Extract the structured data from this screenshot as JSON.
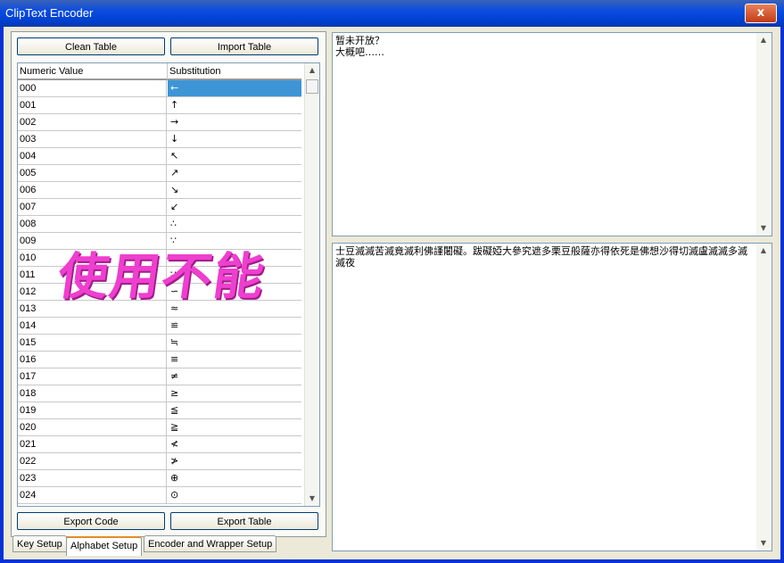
{
  "window": {
    "title": "ClipText Encoder",
    "close_label": "x"
  },
  "buttons": {
    "clean_table": "Clean Table",
    "import_table": "Import Table",
    "export_code": "Export Code",
    "export_table": "Export Table"
  },
  "grid": {
    "headers": [
      "Numeric Value",
      "Substitution"
    ],
    "selected_row": 0,
    "rows": [
      {
        "num": "000",
        "sub": "←"
      },
      {
        "num": "001",
        "sub": "↑"
      },
      {
        "num": "002",
        "sub": "→"
      },
      {
        "num": "003",
        "sub": "↓"
      },
      {
        "num": "004",
        "sub": "↖"
      },
      {
        "num": "005",
        "sub": "↗"
      },
      {
        "num": "006",
        "sub": "↘"
      },
      {
        "num": "007",
        "sub": "↙"
      },
      {
        "num": "008",
        "sub": "∴"
      },
      {
        "num": "009",
        "sub": "∵"
      },
      {
        "num": "010",
        "sub": "∶"
      },
      {
        "num": "011",
        "sub": "∷"
      },
      {
        "num": "012",
        "sub": "∽"
      },
      {
        "num": "013",
        "sub": "≈"
      },
      {
        "num": "014",
        "sub": "≌"
      },
      {
        "num": "015",
        "sub": "≒"
      },
      {
        "num": "016",
        "sub": "≡"
      },
      {
        "num": "017",
        "sub": "≠"
      },
      {
        "num": "018",
        "sub": "≥"
      },
      {
        "num": "019",
        "sub": "≦"
      },
      {
        "num": "020",
        "sub": "≧"
      },
      {
        "num": "021",
        "sub": "≮"
      },
      {
        "num": "022",
        "sub": "≯"
      },
      {
        "num": "023",
        "sub": "⊕"
      },
      {
        "num": "024",
        "sub": "⊙"
      }
    ]
  },
  "tabs": [
    "Key Setup",
    "Alphabet Setup",
    "Encoder and Wrapper Setup"
  ],
  "active_tab": 1,
  "input_text": "暂未开放？\n大概吧……",
  "output_text": "士豆滅滅苦滅竟滅利佛謹闍礙。跋礙婭大參究遮多栗豆般薩亦得依死是佛想沙得切滅盧滅滅多滅滅夜",
  "watermark": "使用不能",
  "colors": {
    "selection": "#3d95d6",
    "titlebar": "#0b4de0",
    "watermark": "#ee3fcf"
  }
}
